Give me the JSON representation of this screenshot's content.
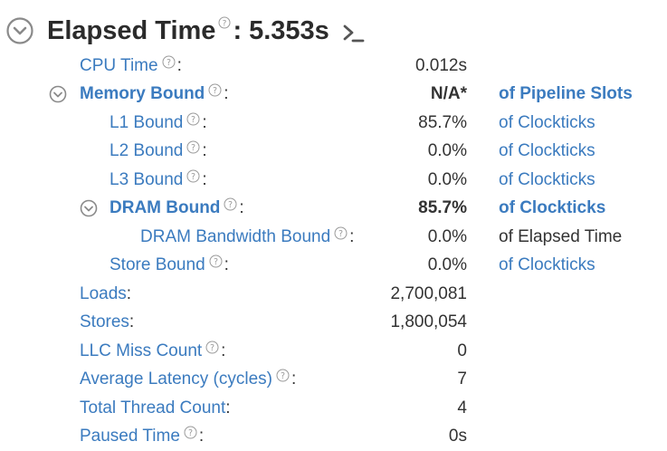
{
  "header": {
    "title": "Elapsed Time",
    "colon": ":",
    "value": "5.353s"
  },
  "metrics": [
    {
      "label": "CPU Time",
      "colon": ":",
      "value": "0.012s",
      "unit": ""
    },
    {
      "label": "Memory Bound",
      "colon": ":",
      "value": "N/A*",
      "unit": "of Pipeline Slots"
    },
    {
      "label": "L1 Bound",
      "colon": ":",
      "value": "85.7%",
      "unit": "of Clockticks"
    },
    {
      "label": "L2 Bound",
      "colon": ":",
      "value": "0.0%",
      "unit": "of Clockticks"
    },
    {
      "label": "L3 Bound",
      "colon": ":",
      "value": "0.0%",
      "unit": "of Clockticks"
    },
    {
      "label": "DRAM Bound",
      "colon": ":",
      "value": "85.7%",
      "unit": "of Clockticks"
    },
    {
      "label": "DRAM Bandwidth Bound",
      "colon": ":",
      "value": "0.0%",
      "unit": "of Elapsed Time"
    },
    {
      "label": "Store Bound",
      "colon": ":",
      "value": "0.0%",
      "unit": "of Clockticks"
    },
    {
      "label": "Loads",
      "colon": ":",
      "value": "2,700,081",
      "unit": ""
    },
    {
      "label": "Stores",
      "colon": ":",
      "value": "1,800,054",
      "unit": ""
    },
    {
      "label": "LLC Miss Count",
      "colon": ":",
      "value": "0",
      "unit": ""
    },
    {
      "label": "Average Latency (cycles)",
      "colon": ":",
      "value": "7",
      "unit": ""
    },
    {
      "label": "Total Thread Count",
      "colon": ":",
      "value": "4",
      "unit": ""
    },
    {
      "label": "Paused Time",
      "colon": ":",
      "value": "0s",
      "unit": ""
    }
  ],
  "colors": {
    "link": "#3b7bbf",
    "text": "#333333",
    "icon": "#8a8a8a"
  }
}
